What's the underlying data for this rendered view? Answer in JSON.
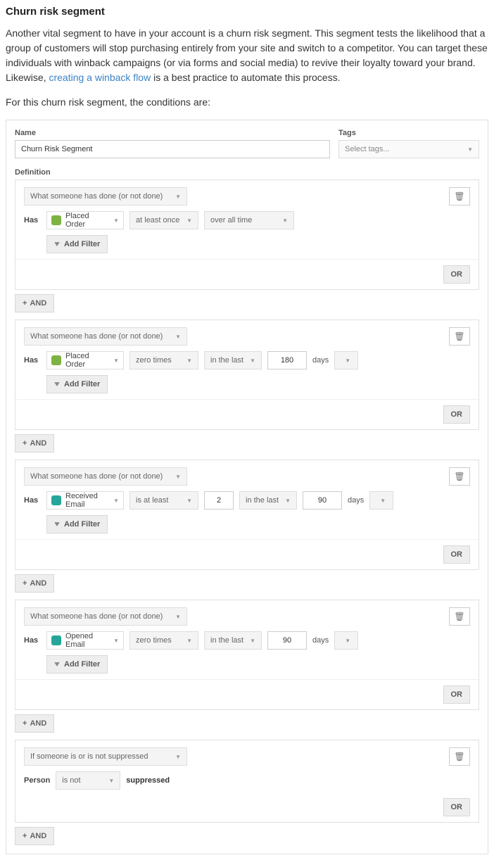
{
  "title": "Churn risk segment",
  "para1": "Another vital segment to have in your account is a churn risk segment. This segment tests the likelihood that a group of customers will stop purchasing entirely from your site and switch to a competitor. You can target these individuals with winback campaigns (or via forms and social media) to revive their loyalty toward your brand. Likewise, ",
  "link_text": "creating a winback flow",
  "para1b": " is a best practice to automate this process.",
  "para2": "For this churn risk segment, the conditions are:",
  "labels": {
    "name": "Name",
    "tags": "Tags",
    "definition": "Definition",
    "has": "Has",
    "person": "Person",
    "days": "days",
    "suppressed": "suppressed"
  },
  "name_value": "Churn Risk Segment",
  "tags_placeholder": "Select tags...",
  "buttons": {
    "add_filter": "Add Filter",
    "and": "AND",
    "or": "OR"
  },
  "cond_type_done": "What someone has done (or not done)",
  "cond_type_supp": "If someone is or is not suppressed",
  "groups": [
    {
      "event": "Placed Order",
      "icon": "green",
      "op": "at least once",
      "count": "",
      "range": "over all time",
      "range_val": "",
      "unit": ""
    },
    {
      "event": "Placed Order",
      "icon": "green",
      "op": "zero times",
      "count": "",
      "range": "in the last",
      "range_val": "180",
      "unit": "days"
    },
    {
      "event": "Received Email",
      "icon": "teal",
      "op": "is at least",
      "count": "2",
      "range": "in the last",
      "range_val": "90",
      "unit": "days"
    },
    {
      "event": "Opened Email",
      "icon": "teal",
      "op": "zero times",
      "count": "",
      "range": "in the last",
      "range_val": "90",
      "unit": "days"
    }
  ],
  "supp_op": "is not"
}
